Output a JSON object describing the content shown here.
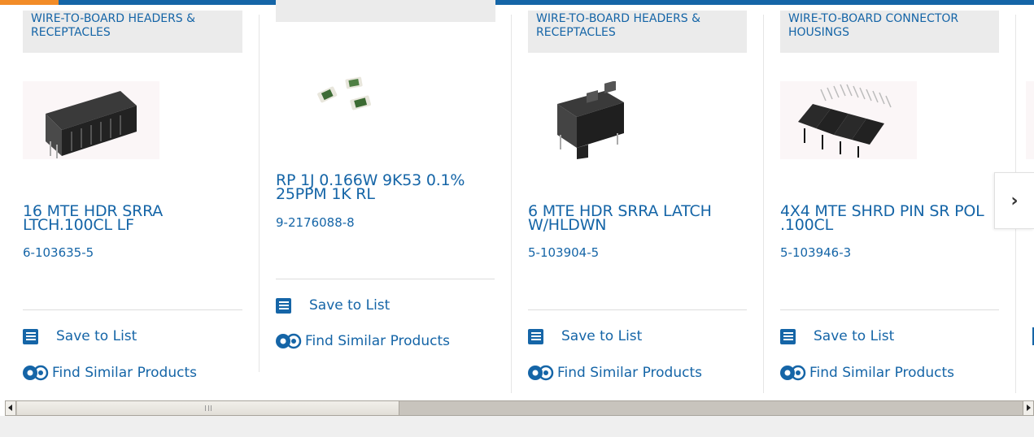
{
  "actions": {
    "save_label": "Save to List",
    "similar_label": "Find Similar Products"
  },
  "navigation": {
    "next_glyph": "›"
  },
  "products": [
    {
      "category": "WIRE-TO-BOARD HEADERS & RECEPTACLES",
      "title": "16 MTE HDR SRRA LTCH.100CL LF",
      "part_number": "6-103635-5",
      "image_icon": "right-angle-header-connector"
    },
    {
      "category": "",
      "title": "RP 1J 0.166W 9K53 0.1% 25PPM 1K RL",
      "part_number": "9-2176088-8",
      "image_icon": "chip-resistors"
    },
    {
      "category": "WIRE-TO-BOARD HEADERS & RECEPTACLES",
      "title": "6 MTE HDR SRRA LATCH W/HLDWN",
      "part_number": "5-103904-5",
      "image_icon": "latch-header-connector"
    },
    {
      "category": "WIRE-TO-BOARD CONNECTOR HOUSINGS",
      "title": "4X4 MTE SHRD PIN SR POL .100CL",
      "part_number": "5-103946-3",
      "image_icon": "connector-housing-strip"
    }
  ],
  "colors": {
    "brand": "#1565a7",
    "accent": "#f28c28",
    "category_bg": "#ebebeb"
  }
}
